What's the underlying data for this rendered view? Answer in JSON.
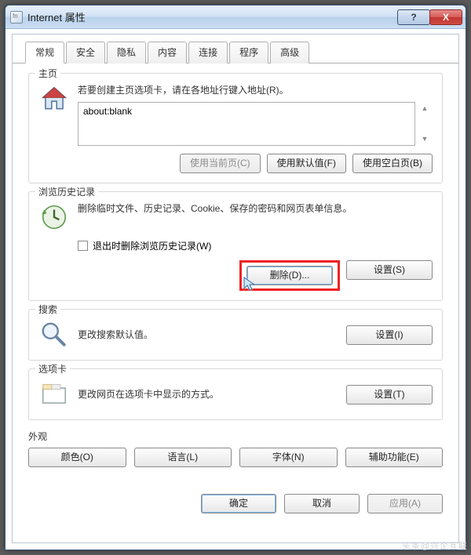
{
  "window": {
    "title": "Internet 属性"
  },
  "tabs": {
    "items": [
      {
        "label": "常规"
      },
      {
        "label": "安全"
      },
      {
        "label": "隐私"
      },
      {
        "label": "内容"
      },
      {
        "label": "连接"
      },
      {
        "label": "程序"
      },
      {
        "label": "高级"
      }
    ],
    "active_index": 0
  },
  "homepage": {
    "legend": "主页",
    "desc": "若要创建主页选项卡，请在各地址行键入地址(R)。",
    "value": "about:blank",
    "use_current": "使用当前页(C)",
    "use_default": "使用默认值(F)",
    "use_blank": "使用空白页(B)"
  },
  "history": {
    "legend": "浏览历史记录",
    "desc": "删除临时文件、历史记录、Cookie、保存的密码和网页表单信息。",
    "checkbox_label": "退出时删除浏览历史记录(W)",
    "delete": "删除(D)...",
    "settings": "设置(S)"
  },
  "search": {
    "legend": "搜索",
    "desc": "更改搜索默认值。",
    "settings": "设置(I)"
  },
  "tabs_group": {
    "legend": "选项卡",
    "desc": "更改网页在选项卡中显示的方式。",
    "settings": "设置(T)"
  },
  "appearance": {
    "legend": "外观",
    "colors": "颜色(O)",
    "languages": "语言(L)",
    "fonts": "字体(N)",
    "accessibility": "辅助功能(E)"
  },
  "dialog": {
    "ok": "确定",
    "cancel": "取消",
    "apply": "应用(A)"
  },
  "winbuttons": {
    "help": "?",
    "close": "X"
  },
  "watermark": "头条@兴企互联"
}
